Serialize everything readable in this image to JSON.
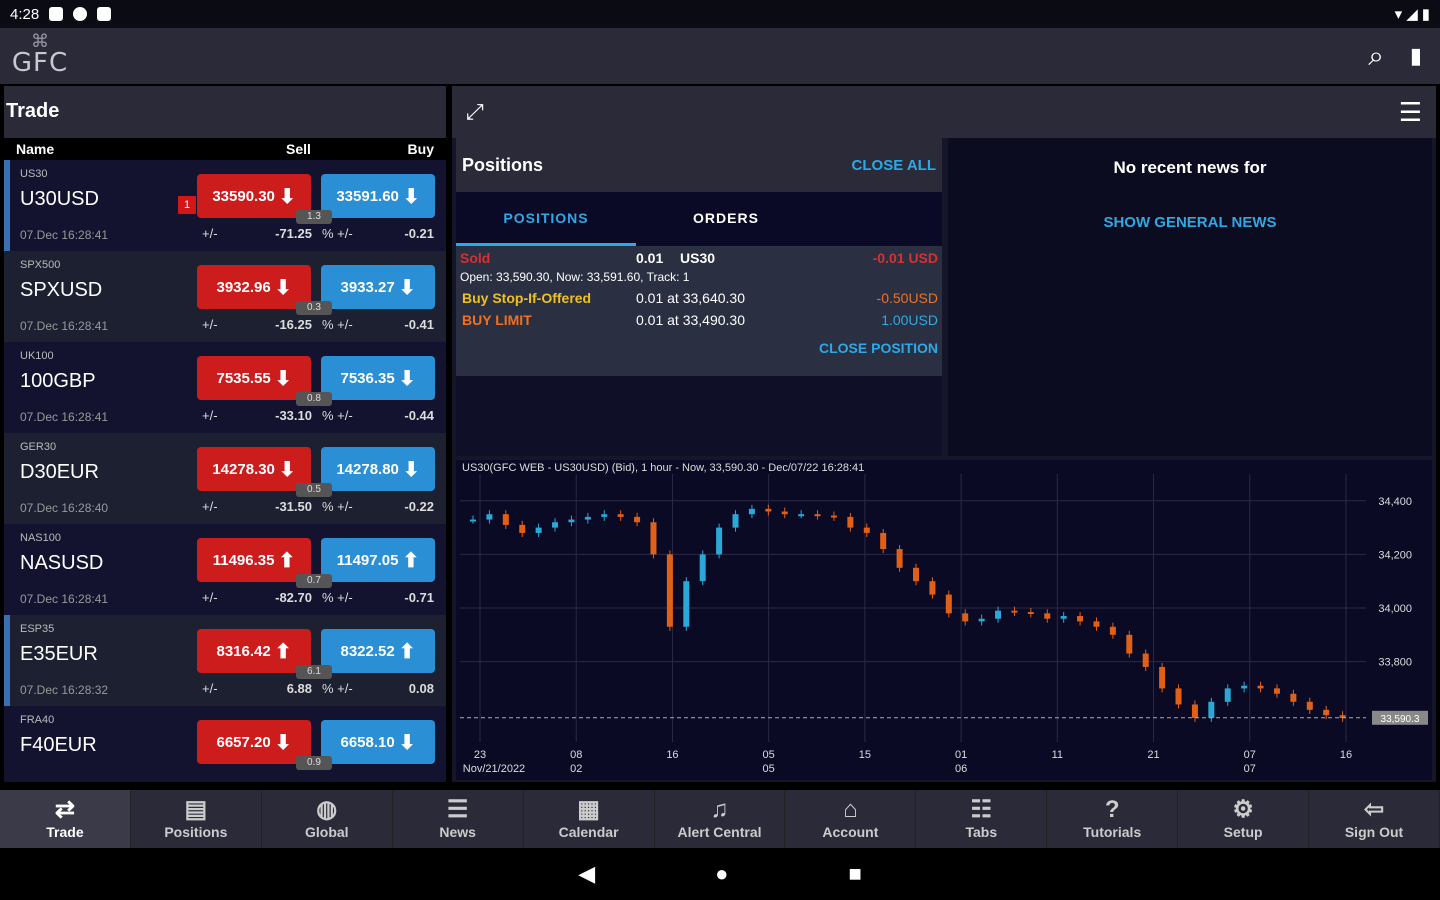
{
  "status": {
    "time": "4:28"
  },
  "brand": {
    "logo_text": "GFC"
  },
  "trade": {
    "title": "Trade",
    "columns": {
      "name": "Name",
      "sell": "Sell",
      "buy": "Buy"
    },
    "rows": [
      {
        "code": "US30",
        "symbol": "U30USD",
        "date": "07.Dec 16:28:41",
        "sell": "33590.30",
        "buy": "33591.60",
        "spread": "1.3",
        "pm_label": "+/-",
        "change": "-71.25",
        "pct_label": "% +/-",
        "pct": "-0.21",
        "badge": "1"
      },
      {
        "code": "SPX500",
        "symbol": "SPXUSD",
        "date": "07.Dec 16:28:41",
        "sell": "3932.96",
        "buy": "3933.27",
        "spread": "0.3",
        "pm_label": "+/-",
        "change": "-16.25",
        "pct_label": "% +/-",
        "pct": "-0.41"
      },
      {
        "code": "UK100",
        "symbol": "100GBP",
        "date": "07.Dec 16:28:41",
        "sell": "7535.55",
        "buy": "7536.35",
        "spread": "0.8",
        "pm_label": "+/-",
        "change": "-33.10",
        "pct_label": "% +/-",
        "pct": "-0.44"
      },
      {
        "code": "GER30",
        "symbol": "D30EUR",
        "date": "07.Dec 16:28:40",
        "sell": "14278.30",
        "buy": "14278.80",
        "spread": "0.5",
        "pm_label": "+/-",
        "change": "-31.50",
        "pct_label": "% +/-",
        "pct": "-0.22"
      },
      {
        "code": "NAS100",
        "symbol": "NASUSD",
        "date": "07.Dec 16:28:41",
        "sell": "11496.35",
        "buy": "11497.05",
        "spread": "0.7",
        "pm_label": "+/-",
        "change": "-82.70",
        "pct_label": "% +/-",
        "pct": "-0.71"
      },
      {
        "code": "ESP35",
        "symbol": "E35EUR",
        "date": "07.Dec 16:28:32",
        "sell": "8316.42",
        "buy": "8322.52",
        "spread": "6.1",
        "pm_label": "+/-",
        "change": "6.88",
        "pct_label": "% +/-",
        "pct": "0.08"
      },
      {
        "code": "FRA40",
        "symbol": "F40EUR",
        "date": "",
        "sell": "6657.20",
        "buy": "6658.10",
        "spread": "0.9",
        "pm_label": "+/-",
        "change": "",
        "pct_label": "% +/-",
        "pct": ""
      }
    ]
  },
  "positions": {
    "title": "Positions",
    "close_all": "CLOSE ALL",
    "tabs": [
      "POSITIONS",
      "ORDERS"
    ],
    "item": {
      "side": "Sold",
      "qty": "0.01",
      "symbol": "US30",
      "pl": "-0.01 USD",
      "open_line": "Open: 33,590.30, Now: 33,591.60, Track: 1",
      "orders": [
        {
          "label": "Buy Stop-If-Offered",
          "detail": "0.01 at 33,640.30",
          "value": "-0.50USD"
        },
        {
          "label": "BUY LIMIT",
          "detail": "0.01 at 33,490.30",
          "value": "1.00USD"
        }
      ],
      "close_position": "CLOSE POSITION"
    }
  },
  "news": {
    "title": "No recent news for",
    "link": "SHOW GENERAL NEWS"
  },
  "chart_data": {
    "type": "candlestick",
    "title": "US30(GFC WEB - US30USD) (Bid), 1 hour - Now, 33,590.30 - Dec/07/22 16:28:41",
    "x_ticks": [
      {
        "top": "23",
        "bottom": "Nov/21/2022"
      },
      {
        "top": "08",
        "bottom": "02"
      },
      {
        "top": "16",
        "bottom": ""
      },
      {
        "top": "05",
        "bottom": "05"
      },
      {
        "top": "15",
        "bottom": ""
      },
      {
        "top": "01",
        "bottom": "06"
      },
      {
        "top": "11",
        "bottom": ""
      },
      {
        "top": "21",
        "bottom": ""
      },
      {
        "top": "07",
        "bottom": "07"
      },
      {
        "top": "16",
        "bottom": ""
      }
    ],
    "y_ticks": [
      "34,400",
      "34,200",
      "34,000",
      "33,800"
    ],
    "ylim": [
      33500,
      34500
    ],
    "current_value": "33,590.3",
    "colors": {
      "up": "#2aa8d8",
      "down": "#e06018",
      "grid": "#2a2a48"
    }
  },
  "bottom_nav": [
    {
      "label": "Trade",
      "icon": "⇄"
    },
    {
      "label": "Positions",
      "icon": "▤"
    },
    {
      "label": "Global",
      "icon": "◍"
    },
    {
      "label": "News",
      "icon": "☰"
    },
    {
      "label": "Calendar",
      "icon": "▦"
    },
    {
      "label": "Alert Central",
      "icon": "♫"
    },
    {
      "label": "Account",
      "icon": "⌂"
    },
    {
      "label": "Tabs",
      "icon": "☷"
    },
    {
      "label": "Tutorials",
      "icon": "?"
    },
    {
      "label": "Setup",
      "icon": "⚙"
    },
    {
      "label": "Sign Out",
      "icon": "⇦"
    }
  ]
}
